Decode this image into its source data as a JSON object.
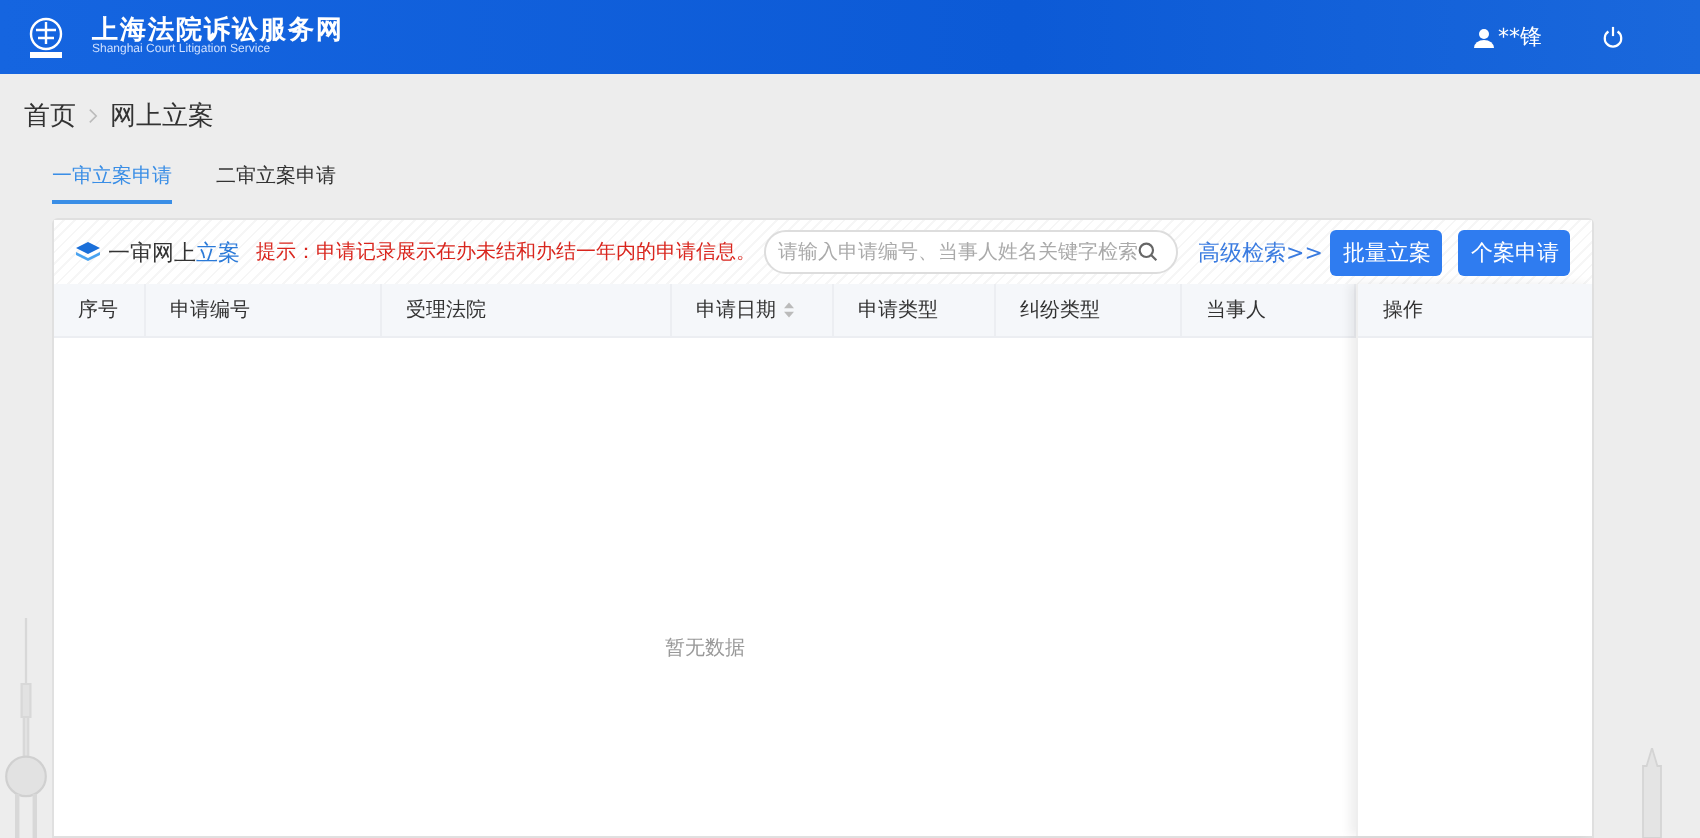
{
  "header": {
    "title": "上海法院诉讼服务网",
    "subtitle": "Shanghai Court Litigation Service",
    "user": "**锋"
  },
  "breadcrumb": [
    "首页",
    "网上立案"
  ],
  "tabs": [
    {
      "label": "一审立案申请",
      "selected": true
    },
    {
      "label": "二审立案申请",
      "selected": false
    }
  ],
  "panel": {
    "title_prefix": "一审网上",
    "title_highlight": "立案",
    "tip": "提示：申请记录展示在办未结和办结一年内的申请信息。",
    "search": {
      "placeholder": "请输入申请编号、当事人姓名关键字检索"
    },
    "advanced_search": "高级检索>>",
    "buttons": [
      "批量立案",
      "个案申请"
    ]
  },
  "table": {
    "columns": [
      {
        "label": "序号",
        "sortable": false
      },
      {
        "label": "申请编号",
        "sortable": false
      },
      {
        "label": "受理法院",
        "sortable": false
      },
      {
        "label": "申请日期",
        "sortable": true
      },
      {
        "label": "申请类型",
        "sortable": false
      },
      {
        "label": "纠纷类型",
        "sortable": false
      },
      {
        "label": "当事人",
        "sortable": false
      }
    ],
    "fixed_column": "操作",
    "empty_text": "暂无数据"
  }
}
